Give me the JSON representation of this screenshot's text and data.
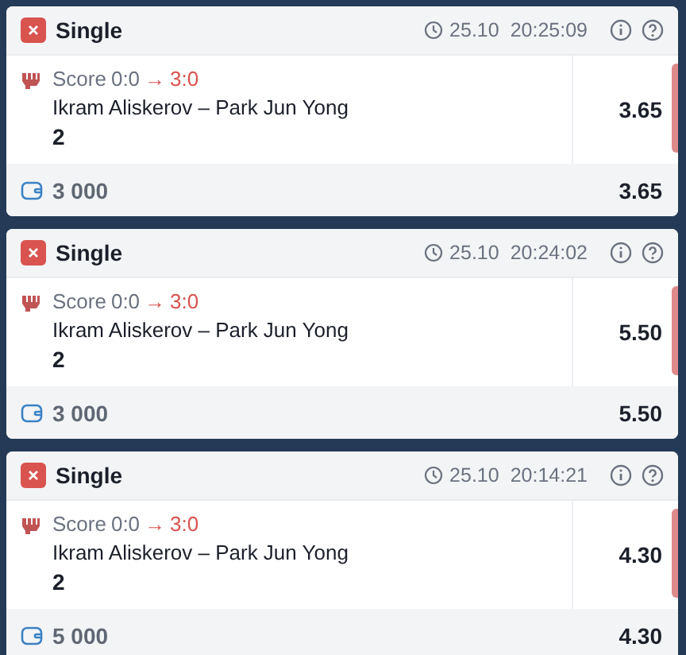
{
  "bets": [
    {
      "type": "Single",
      "date": "25.10",
      "time": "20:25:09",
      "score_label": "Score",
      "score_from": "0:0",
      "score_arrow": "→",
      "score_to": "3:0",
      "event": "Ikram Aliskerov – Park Jun Yong",
      "selection": "2",
      "odds": "3.65",
      "stake": "3 000",
      "total_odds": "3.65"
    },
    {
      "type": "Single",
      "date": "25.10",
      "time": "20:24:02",
      "score_label": "Score",
      "score_from": "0:0",
      "score_arrow": "→",
      "score_to": "3:0",
      "event": "Ikram Aliskerov – Park Jun Yong",
      "selection": "2",
      "odds": "5.50",
      "stake": "3 000",
      "total_odds": "5.50"
    },
    {
      "type": "Single",
      "date": "25.10",
      "time": "20:14:21",
      "score_label": "Score",
      "score_from": "0:0",
      "score_arrow": "→",
      "score_to": "3:0",
      "event": "Ikram Aliskerov – Park Jun Yong",
      "selection": "2",
      "odds": "4.30",
      "stake": "5 000",
      "total_odds": "4.30"
    }
  ]
}
